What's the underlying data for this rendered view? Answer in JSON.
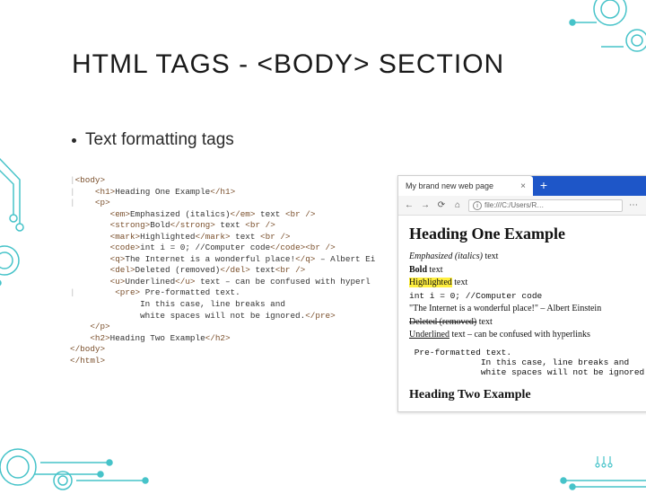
{
  "title": "HTML TAGS - <BODY> SECTION",
  "bullet": "Text formatting tags",
  "code": {
    "l1a": "|",
    "l1b": "<body>",
    "l2a": "|",
    "l2b": "    <h1>",
    "l2c": "Heading One Example",
    "l2d": "</h1>",
    "l3a": "|",
    "l3b": "    <p>",
    "l4a": "        <em>",
    "l4b": "Emphasized (italics)",
    "l4c": "</em>",
    "l4d": " text ",
    "l4e": "<br />",
    "l5a": "        <strong>",
    "l5b": "Bold",
    "l5c": "</strong>",
    "l5d": " text ",
    "l5e": "<br />",
    "l6a": "        <mark>",
    "l6b": "Highlighted",
    "l6c": "</mark>",
    "l6d": " text ",
    "l6e": "<br />",
    "l7a": "        <code>",
    "l7b": "int i = 0; //Computer code",
    "l7c": "</code><br />",
    "l8a": "        <q>",
    "l8b": "The Internet is a wonderful place!",
    "l8c": "</q>",
    "l8d": " – Albert Ei",
    "l9a": "        <del>",
    "l9b": "Deleted (removed)",
    "l9c": "</del>",
    "l9d": " text",
    "l9e": "<br />",
    "l10a": "        <u>",
    "l10b": "Underlined",
    "l10c": "</u>",
    "l10d": " text – can be confused with hyperl",
    "l11a": "|",
    "l11b": "        <pre>",
    "l11c": " Pre-formatted text.",
    "l12": "              In this case, line breaks and",
    "l13a": "              white spaces will not be ignored.",
    "l13b": "</pre>",
    "l14a": "    </p>",
    "l15a": "    <h2>",
    "l15b": "Heading Two Example",
    "l15c": "</h2>",
    "l16a": "</body>",
    "l17a": "</html>"
  },
  "browser": {
    "tab_label": "My brand new web page",
    "tab_close": "×",
    "tab_plus": "+",
    "nav": {
      "back": "←",
      "fwd": "→",
      "reload": "⟳",
      "home": "⌂",
      "info": "i",
      "more": "⋯",
      "bookmark": "☆"
    },
    "url": "file:///C:/Users/R…",
    "page": {
      "h1": "Heading One Example",
      "line_em": "Emphasized (italics)",
      "line_em_tail": " text",
      "line_bold": "Bold",
      "line_bold_tail": " text",
      "line_hl": "Highlighted",
      "line_hl_tail": " text",
      "line_code": "int i = 0; //Computer code",
      "line_q": "\"The Internet is a wonderful place!\" – Albert Einstein",
      "line_del": "Deleted (removed)",
      "line_del_tail": " text",
      "line_u": "Underlined",
      "line_u_tail": " text – can be confused with hyperlinks",
      "pre": " Pre-formatted text.\n              In this case, line breaks and\n              white spaces will not be ignored.",
      "h2": "Heading Two Example"
    }
  }
}
